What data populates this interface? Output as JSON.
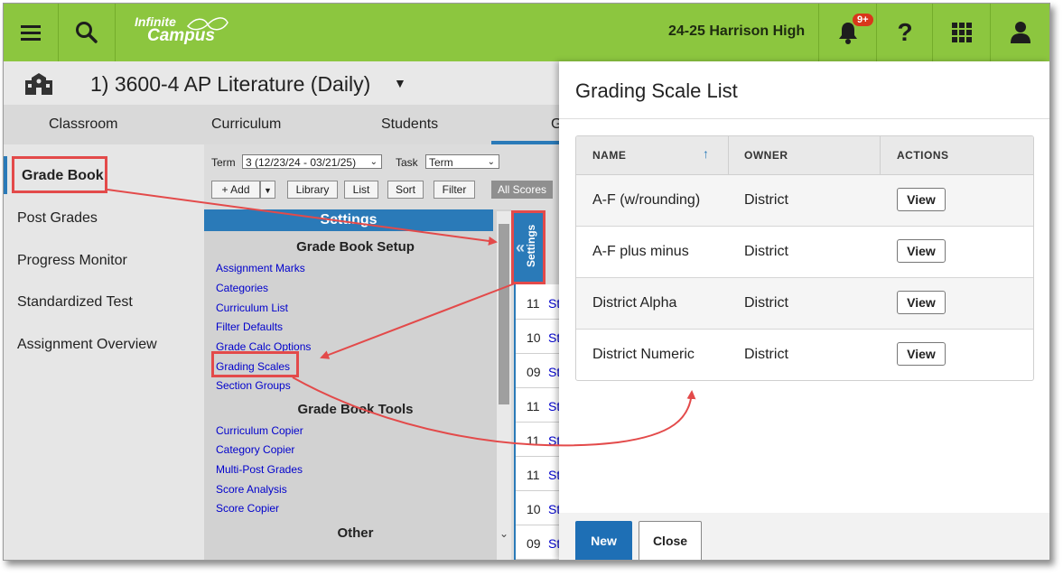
{
  "topbar": {
    "logo_line1": "Infinite",
    "logo_line2": "Campus",
    "school": "24-25 Harrison High",
    "notifications_badge": "9+",
    "icons": [
      "menu-icon",
      "search-icon",
      "bell-icon",
      "help-icon",
      "apps-grid-icon",
      "user-icon"
    ]
  },
  "course": {
    "title": "1) 3600-4 AP Literature (Daily)"
  },
  "tabs": [
    "Classroom",
    "Curriculum",
    "Students",
    "G"
  ],
  "leftnav": {
    "items": [
      "Grade Book",
      "Post Grades",
      "Progress Monitor",
      "Standardized Test",
      "Assignment Overview"
    ]
  },
  "gradebook": {
    "term_label": "Term",
    "term_value": "3 (12/23/24 - 03/21/25)",
    "task_label": "Task",
    "task_value": "Term",
    "buttons": [
      "+ Add",
      "Library",
      "List",
      "Sort",
      "Filter"
    ],
    "all_scores": "All Scores",
    "settings_title": "Settings",
    "setup_heading": "Grade Book Setup",
    "setup_links": [
      "Assignment Marks",
      "Categories",
      "Curriculum List",
      "Filter Defaults",
      "Grade Calc Options",
      "Grading Scales",
      "Section Groups"
    ],
    "tools_heading": "Grade Book Tools",
    "tools_links": [
      "Curriculum Copier",
      "Category Copier",
      "Multi-Post Grades",
      "Score Analysis",
      "Score Copier"
    ],
    "other_heading": "Other",
    "collapse_label": "Settings",
    "student_rows": [
      {
        "grade": "11",
        "name": "Stu"
      },
      {
        "grade": "10",
        "name": "Stu"
      },
      {
        "grade": "09",
        "name": "Stu"
      },
      {
        "grade": "11",
        "name": "Stu"
      },
      {
        "grade": "11",
        "name": "Stu"
      },
      {
        "grade": "11",
        "name": "Stu"
      },
      {
        "grade": "10",
        "name": "Stu"
      },
      {
        "grade": "09",
        "name": "Stu"
      }
    ]
  },
  "grading_scale_list": {
    "title": "Grading Scale List",
    "columns": [
      "NAME",
      "OWNER",
      "ACTIONS"
    ],
    "rows": [
      {
        "name": "A-F (w/rounding)",
        "owner": "District",
        "action": "View"
      },
      {
        "name": "A-F plus minus",
        "owner": "District",
        "action": "View"
      },
      {
        "name": "District Alpha",
        "owner": "District",
        "action": "View"
      },
      {
        "name": "District Numeric",
        "owner": "District",
        "action": "View"
      }
    ],
    "new_label": "New",
    "close_label": "Close"
  },
  "colors": {
    "brand_green": "#8cc63f",
    "accent_blue": "#2a7ab8",
    "annotation_red": "#e34a4a"
  }
}
